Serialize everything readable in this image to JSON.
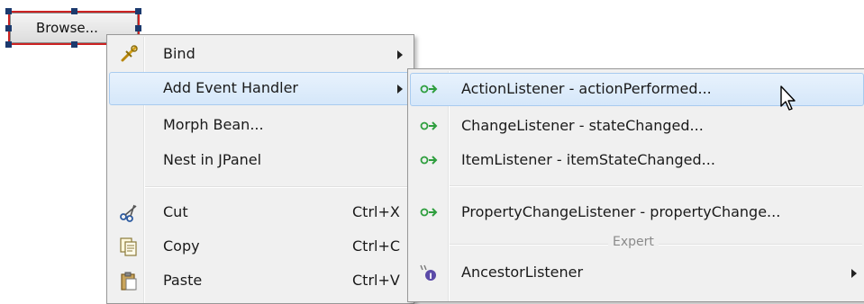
{
  "designer": {
    "selected_button_label": "Browse..."
  },
  "context_menu": {
    "items": [
      {
        "label": "Bind",
        "icon": "binding-icon",
        "has_submenu": true
      },
      {
        "label": "Add Event Handler",
        "has_submenu": true,
        "highlighted": true
      },
      {
        "label": "Morph Bean..."
      },
      {
        "label": "Nest in JPanel"
      },
      {
        "label": "Cut",
        "shortcut": "Ctrl+X",
        "icon": "scissors-icon"
      },
      {
        "label": "Copy",
        "shortcut": "Ctrl+C",
        "icon": "copy-icon"
      },
      {
        "label": "Paste",
        "shortcut": "Ctrl+V",
        "icon": "paste-icon"
      }
    ]
  },
  "submenu": {
    "items": [
      {
        "label": "ActionListener - actionPerformed...",
        "icon": "event-listener-icon",
        "highlighted": true
      },
      {
        "label": "ChangeListener - stateChanged...",
        "icon": "event-listener-icon"
      },
      {
        "label": "ItemListener - itemStateChanged...",
        "icon": "event-listener-icon"
      },
      {
        "label": "PropertyChangeListener - propertyChange...",
        "icon": "event-listener-icon"
      }
    ],
    "group_label": "Expert",
    "expert_items": [
      {
        "label": "AncestorListener",
        "icon": "listener-interface-icon",
        "has_submenu": true
      }
    ]
  },
  "colors": {
    "menu_background": "#f0f0f0",
    "highlight": "#d5e7fa",
    "selection_frame": "#cc2222",
    "listener_icon": "#2e9e3e"
  }
}
